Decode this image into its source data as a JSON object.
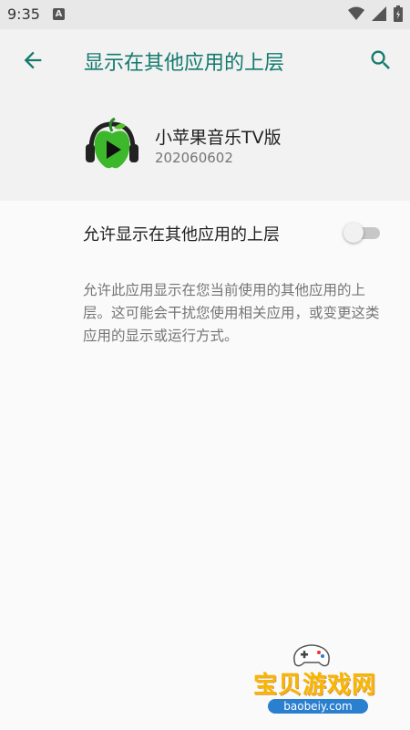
{
  "status_bar": {
    "time": "9:35",
    "notification_icon": "a-icon",
    "icons": [
      "wifi-icon",
      "signal-icon",
      "battery-icon"
    ]
  },
  "app_bar": {
    "title": "显示在其他应用的上层",
    "back_icon": "arrow-left-icon",
    "search_icon": "search-icon"
  },
  "app_info": {
    "name": "小苹果音乐TV版",
    "version": "202060602",
    "icon": "apple-headphones-app-icon"
  },
  "permission": {
    "label": "允许显示在其他应用的上层",
    "enabled": false
  },
  "description": "允许此应用显示在您当前使用的其他应用的上层。这可能会干扰您使用相关应用，或变更这类应用的显示或运行方式。",
  "watermark": {
    "text": "宝贝游戏网",
    "url": "baobeiy.com"
  },
  "colors": {
    "accent": "#137a6e",
    "header_bg": "#f2f2f2",
    "background": "#fafafa"
  }
}
